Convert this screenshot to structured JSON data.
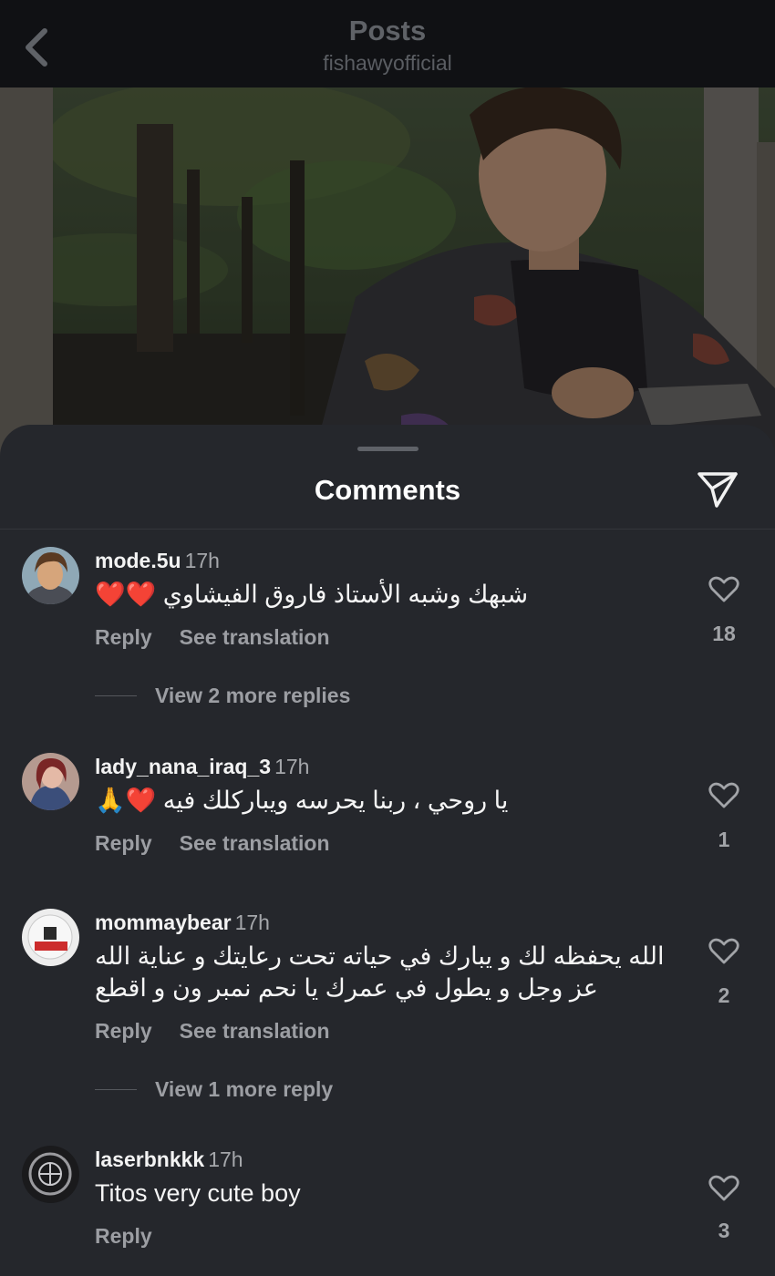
{
  "header": {
    "title": "Posts",
    "subtitle": "fishawyofficial",
    "back_icon": "chevron-left-icon"
  },
  "sheet": {
    "title": "Comments",
    "share_icon": "paper-plane-icon"
  },
  "comments": [
    {
      "username": "mode.5u",
      "time": "17h",
      "text": "شبهك وشبه الأستاذ فاروق الفيشاوي ❤️❤️",
      "reply": "Reply",
      "translate": "See translation",
      "likes": "18",
      "more_replies": "View 2 more replies"
    },
    {
      "username": "lady_nana_iraq_3",
      "time": "17h",
      "text": "يا روحي ، ربنا يحرسه ويباركلك فيه ❤️🙏",
      "reply": "Reply",
      "translate": "See translation",
      "likes": "1"
    },
    {
      "username": "mommaybear",
      "time": "17h",
      "text_line1": "الله يحفظه لك و يبارك في حياته تحت رعايتك و عناية الله",
      "text_line2": "عز وجل و يطول في عمرك يا نحم نمبر ون و اقطع",
      "reply": "Reply",
      "translate": "See translation",
      "likes": "2",
      "more_replies": "View 1 more reply"
    },
    {
      "username": "laserbnkkk",
      "time": "17h",
      "text": "Titos very cute boy",
      "reply": "Reply",
      "likes": "3"
    }
  ],
  "colors": {
    "background": "#25272c",
    "topbar": "#101114",
    "text_primary": "#f5f5f5",
    "text_secondary": "#9c9ea3",
    "heart_red": "#e8322e"
  }
}
